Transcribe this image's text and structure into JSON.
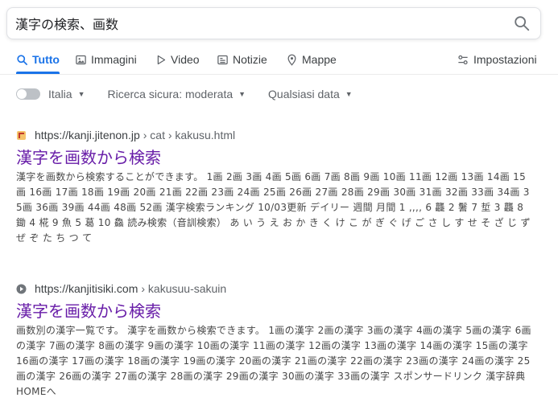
{
  "search": {
    "query": "漢字の検索、画数",
    "button_icon": "search-icon"
  },
  "tabs": [
    {
      "label": "Tutto",
      "icon": "search-icon",
      "active": true
    },
    {
      "label": "Immagini",
      "icon": "image-icon",
      "active": false
    },
    {
      "label": "Video",
      "icon": "play-icon",
      "active": false
    },
    {
      "label": "Notizie",
      "icon": "news-icon",
      "active": false
    },
    {
      "label": "Mappe",
      "icon": "map-pin-icon",
      "active": false
    },
    {
      "label": "Impostazioni",
      "icon": "settings-sliders-icon",
      "active": false
    }
  ],
  "filters": {
    "region": "Italia",
    "safe_search": "Ricerca sicura: moderata",
    "date": "Qualsiasi data"
  },
  "results": [
    {
      "url_domain": "https://kanji.jitenon.jp",
      "url_path": "› cat › kakusu.html",
      "favicon": "jitenon-favicon-icon",
      "title": "漢字を画数から検索",
      "snippet": "漢字を画数から検索することができます。 1画 2画 3画 4画 5画 6画 7画 8画 9画 10画 11画 12画 13画 14画 15画 16画 17画 18画 19画 20画 21画 22画 23画 24画 25画 26画 27画 28画 29画 30画 31画 32画 33画 34画 35画 36画 39画 44画 48画 52画 漢字検索ランキング 10/03更新 デイリー 週間 月間 1 ,,,, 6 龘 2 鬐 7 埑 3 龘 8 鋤 4 椛 9 魚 5 葛 10 鱻 読み検索（音訓検索） あ い う え お か き く け こ が ぎ ぐ げ ご さ し す せ そ ざ じ ず ぜ ぞ た ち つ て"
    },
    {
      "url_domain": "https://kanjitisiki.com",
      "url_path": "› kakusuu-sakuin",
      "favicon": "play-circle-favicon-icon",
      "title": "漢字を画数から検索",
      "snippet": "画数別の漢字一覧です。 漢字を画数から検索できます。 1画の漢字 2画の漢字 3画の漢字 4画の漢字 5画の漢字 6画の漢字 7画の漢字 8画の漢字 9画の漢字 10画の漢字 11画の漢字 12画の漢字 13画の漢字 14画の漢字 15画の漢字 16画の漢字 17画の漢字 18画の漢字 19画の漢字 20画の漢字 21画の漢字 22画の漢字 23画の漢字 24画の漢字 25画の漢字 26画の漢字 27画の漢字 28画の漢字 29画の漢字 30画の漢字 33画の漢字 スポンサードリンク 漢字辞典HOMEへ"
    }
  ],
  "colors": {
    "accent": "#1a73e8",
    "visited_title": "#681da8",
    "snippet": "#474747"
  }
}
